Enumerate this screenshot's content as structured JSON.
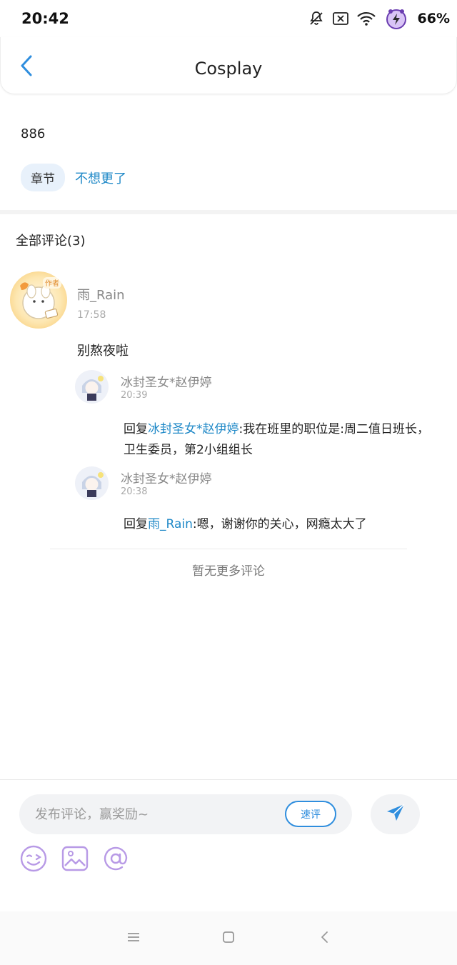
{
  "status_bar": {
    "time": "20:42",
    "battery": "66%"
  },
  "header": {
    "title": "Cosplay"
  },
  "post": {
    "text": "886",
    "tag_label": "章节",
    "tag_link": "不想更了"
  },
  "comments": {
    "title": "全部评论(3)",
    "main": {
      "author": "雨_Rain",
      "time": "17:58",
      "text": "别熬夜啦",
      "badge": "作者"
    },
    "replies": [
      {
        "author": "冰封圣女*赵伊婷",
        "time": "20:39",
        "prefix": "回复",
        "mention": "冰封圣女*赵伊婷",
        "text": ":我在班里的职位是:周二值日班长，卫生委员，第2小组组长"
      },
      {
        "author": "冰封圣女*赵伊婷",
        "time": "20:38",
        "prefix": "回复",
        "mention": "雨_Rain",
        "text": ":嗯，谢谢你的关心，网瘾太大了"
      }
    ],
    "no_more": "暂无更多评论"
  },
  "composer": {
    "placeholder": "发布评论，赢奖励~",
    "quick_label": "速评"
  },
  "colors": {
    "accent": "#1e88c7",
    "tag_bg": "#e8f1fb",
    "icon_purple": "#b89ae6",
    "send_blue": "#2f8ede"
  },
  "icons": {
    "back": "chevron-left-icon",
    "send": "paper-plane-icon",
    "emoji": "emoji-icon",
    "image": "image-icon",
    "mention": "at-icon"
  }
}
